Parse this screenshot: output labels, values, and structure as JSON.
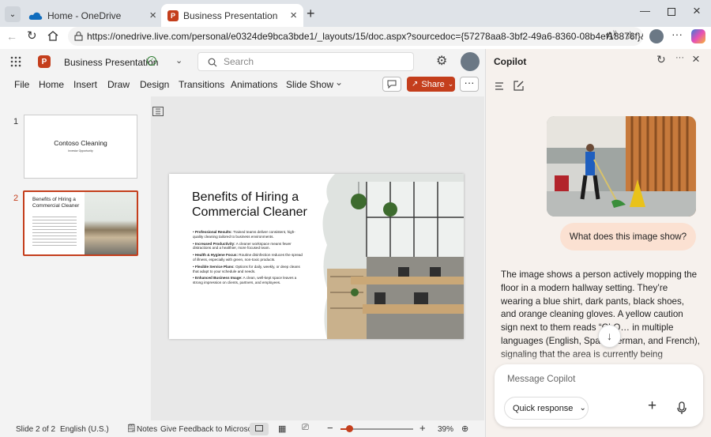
{
  "browser": {
    "tabs": [
      {
        "title": "Home - OneDrive",
        "active": false
      },
      {
        "title": "Business Presentation",
        "active": true
      }
    ],
    "url": "https://onedrive.live.com/personal/e0324de9bca3bde1/_layouts/15/doc.aspx?sourcedoc={57278aa8-3bf2-49a6-8360-08b4ef18876f}&action..."
  },
  "app": {
    "doc_title": "Business Presentation",
    "search_placeholder": "Search",
    "ribbon_tabs": [
      "File",
      "Home",
      "Insert",
      "Draw",
      "Design",
      "Transitions",
      "Animations",
      "Slide Show"
    ],
    "share_label": "Share"
  },
  "slides": [
    {
      "number": "1",
      "title": "Contoso Cleaning",
      "subtitle": "Investor Opportunity"
    },
    {
      "number": "2",
      "title": "Benefits of Hiring a Commercial Cleaner"
    }
  ],
  "current_slide": {
    "title": "Benefits of Hiring a Commercial Cleaner",
    "bullets": [
      {
        "bold": "Professional Results:",
        "text": " Trained teams deliver consistent, high-quality cleaning tailored to business environments."
      },
      {
        "bold": "Increased Productivity:",
        "text": " A cleaner workspace means fewer distractions and a healthier, more focused team."
      },
      {
        "bold": "Health & Hygiene Focus:",
        "text": " Routine disinfection reduces the spread of illness, especially with green, non-toxic products."
      },
      {
        "bold": "Flexible Service Plans:",
        "text": " Options for daily, weekly, or deep cleans that adapt to your schedule and needs."
      },
      {
        "bold": "Enhanced Business Image:",
        "text": " A clean, well-kept space leaves a strong impression on clients, partners, and employees."
      }
    ]
  },
  "status": {
    "slide_count": "Slide 2 of 2",
    "language": "English (U.S.)",
    "notes": "Notes",
    "feedback": "Give Feedback to Microsoft",
    "zoom": "39%",
    "zoom_level": 0.39
  },
  "copilot": {
    "title": "Copilot",
    "user_message": "What does this image show?",
    "response": "The image shows a person actively mopping the floor in a modern hallway setting. They’re wearing a blue shirt, dark pants, black shoes, and orange cleaning gloves. A yellow caution sign next to them reads “CLO… in multiple languages (English, Span… erman, and French), signaling that the area is currently being",
    "input_placeholder": "Message Copilot",
    "mode": "Quick response"
  },
  "colors": {
    "accent": "#c43e1c",
    "share_bg": "#c43e1c",
    "user_bubble": "#fbe1d2",
    "copilot_bg": "#f6f1ed"
  }
}
